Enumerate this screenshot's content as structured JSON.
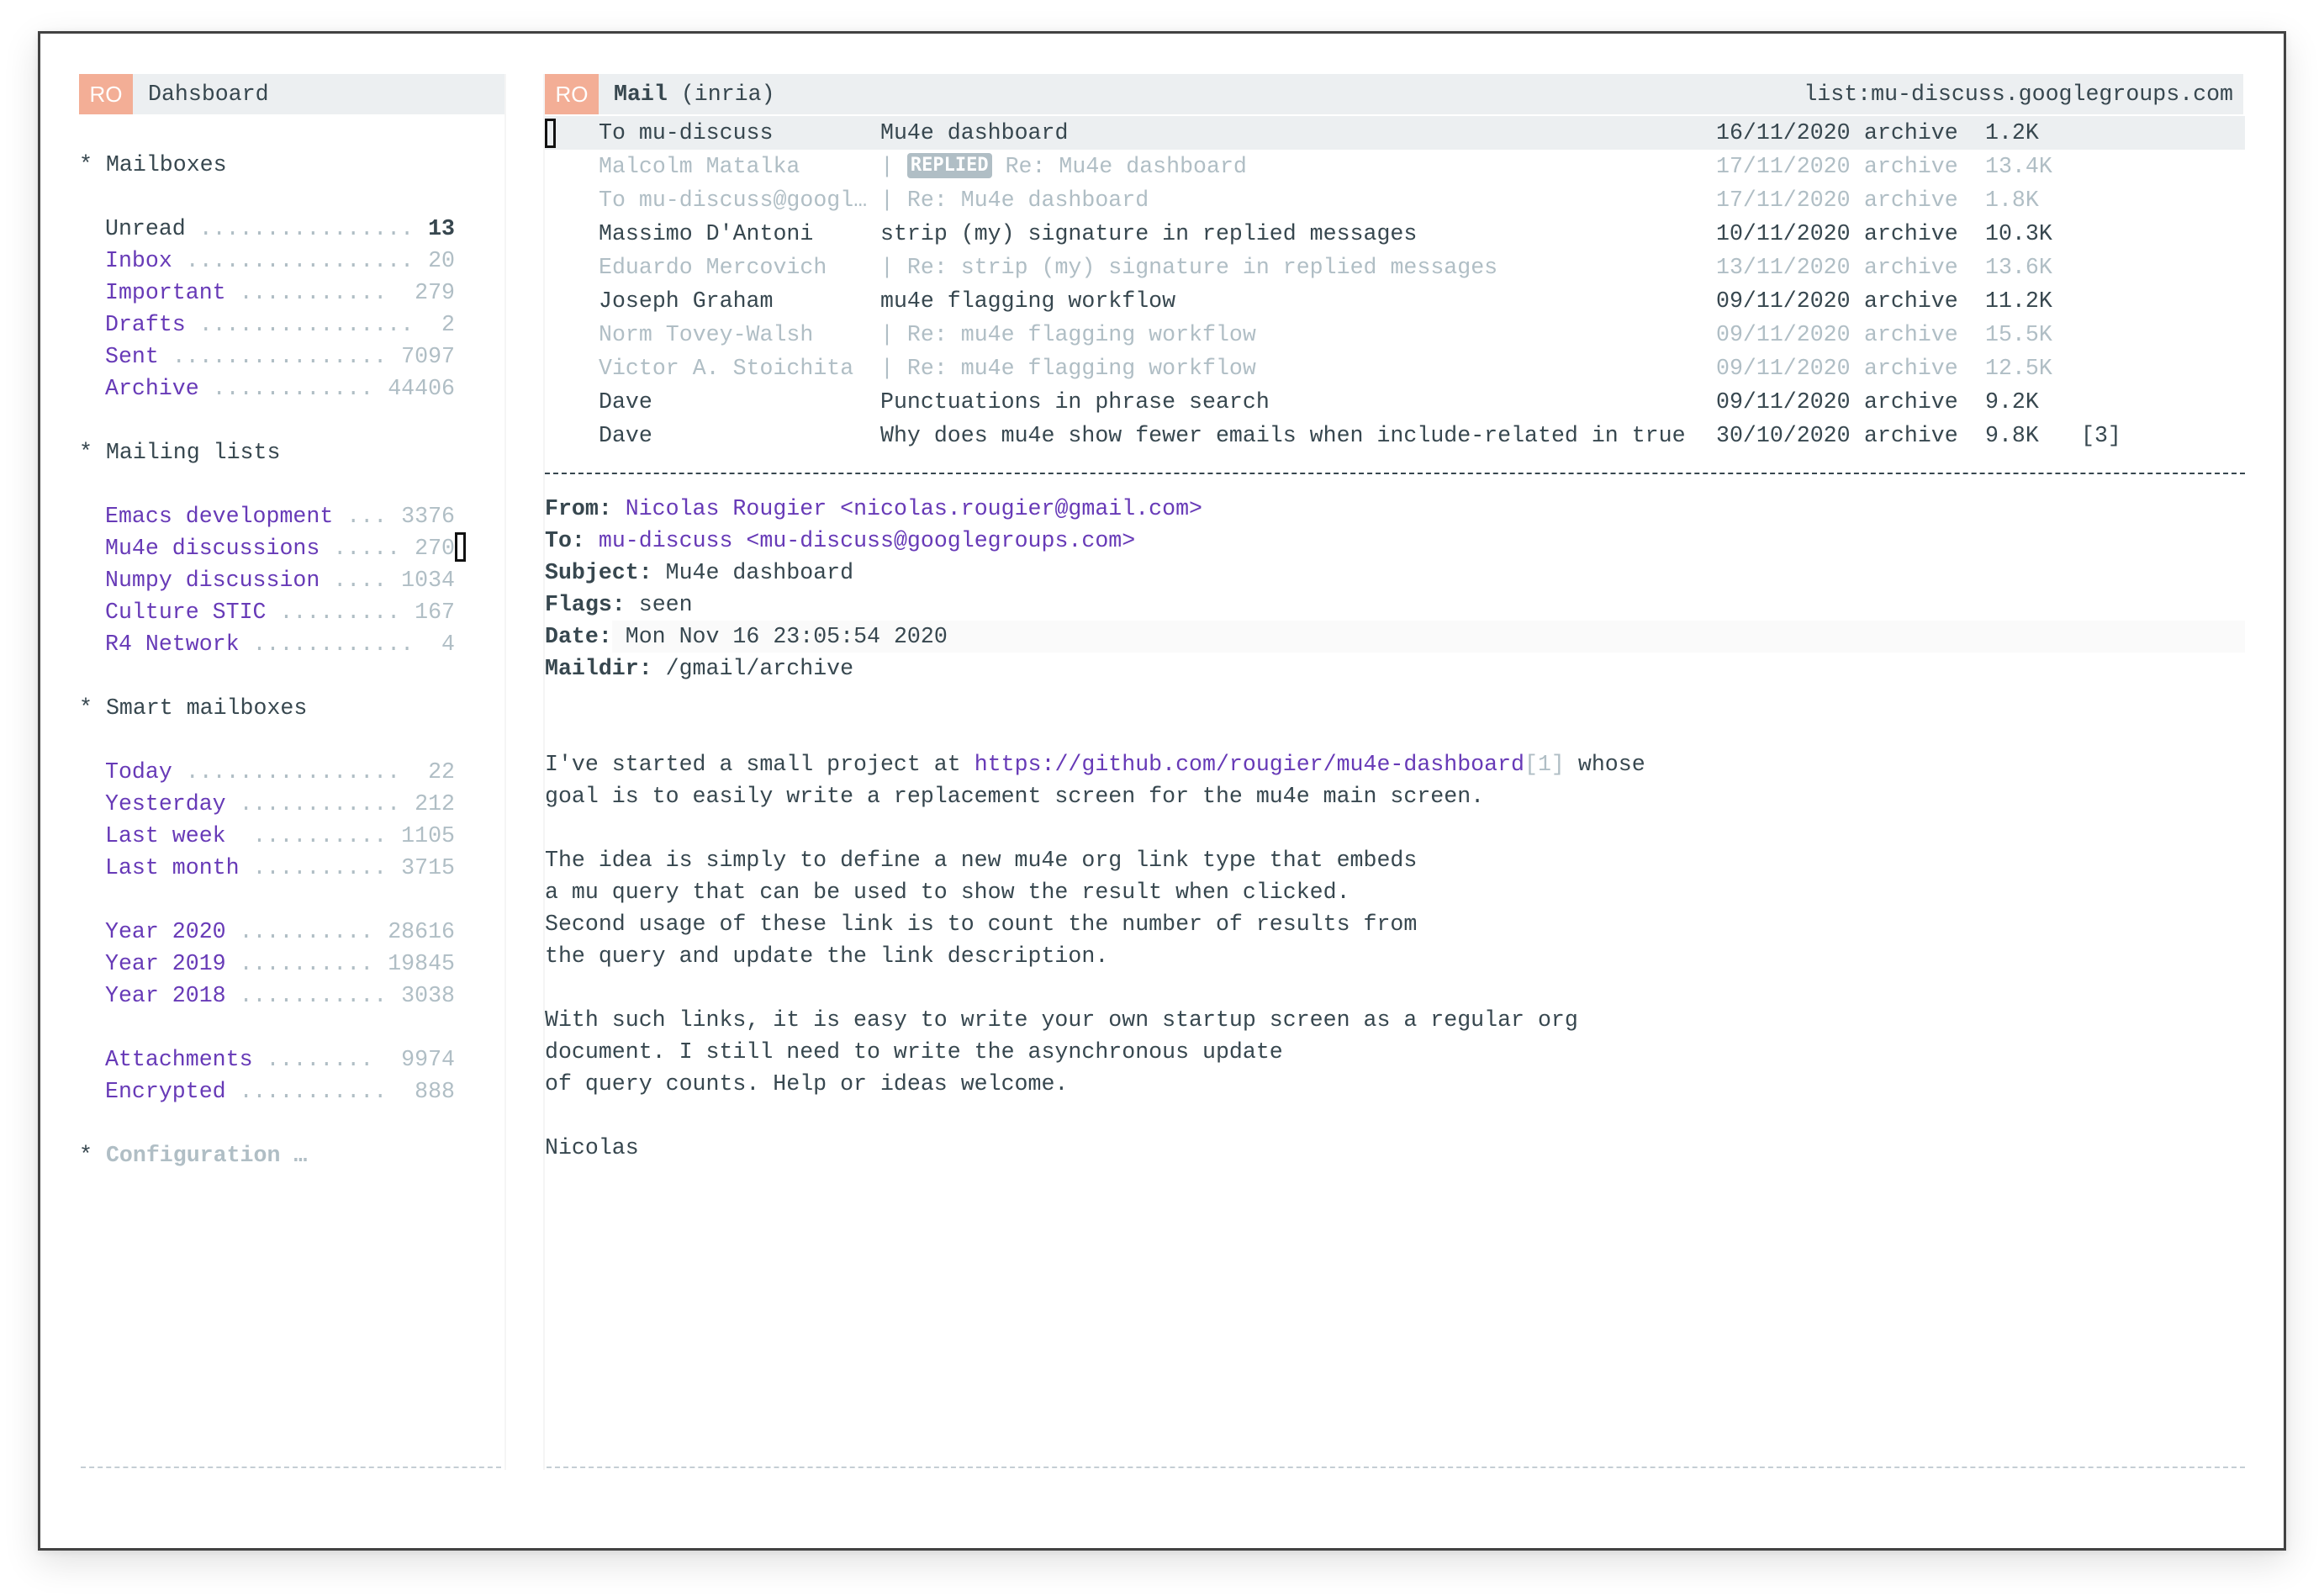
{
  "sidebar": {
    "badge": "RO",
    "title": "Dahsboard",
    "sections": {
      "mailboxes": {
        "heading": "Mailboxes",
        "items": [
          {
            "label": "Unread",
            "dots": "................",
            "count": "13"
          },
          {
            "label": "Inbox",
            "dots": ".................",
            "count": "20"
          },
          {
            "label": "Important",
            "dots": "...........",
            "count": "279"
          },
          {
            "label": "Drafts",
            "dots": "................",
            "count": "2"
          },
          {
            "label": "Sent",
            "dots": "................",
            "count": "7097"
          },
          {
            "label": "Archive",
            "dots": "............",
            "count": "44406"
          }
        ]
      },
      "mailing_lists": {
        "heading": "Mailing lists",
        "items": [
          {
            "label": "Emacs development",
            "dots": "...",
            "count": "3376"
          },
          {
            "label": "Mu4e discussions",
            "dots": ".....",
            "count": "270"
          },
          {
            "label": "Numpy discussion",
            "dots": "....",
            "count": "1034"
          },
          {
            "label": "Culture STIC",
            "dots": ".........",
            "count": "167"
          },
          {
            "label": "R4 Network",
            "dots": "............",
            "count": "4"
          }
        ]
      },
      "smart_mailboxes": {
        "heading": "Smart mailboxes",
        "items": [
          {
            "label": "Today",
            "dots": "................",
            "count": "22"
          },
          {
            "label": "Yesterday",
            "dots": "............",
            "count": "212"
          },
          {
            "label": "Last week",
            "dots": " ..........",
            "count": "1105"
          },
          {
            "label": "Last month",
            "dots": "..........",
            "count": "3715"
          },
          {
            "label": "Year 2020",
            "dots": "..........",
            "count": "28616"
          },
          {
            "label": "Year 2019",
            "dots": "..........",
            "count": "19845"
          },
          {
            "label": "Year 2018",
            "dots": "...........",
            "count": "3038"
          },
          {
            "label": "Attachments",
            "dots": "........",
            "count": "9974"
          },
          {
            "label": "Encrypted",
            "dots": "...........",
            "count": "888"
          }
        ]
      },
      "configuration": {
        "heading": "Configuration …"
      }
    },
    "star": "*"
  },
  "mail": {
    "badge": "RO",
    "title": "Mail",
    "account": "(inria)",
    "query": "list:mu-discuss.googlegroups.com",
    "messages": [
      {
        "from": "To mu-discuss",
        "prefix": "",
        "tag": "",
        "subject": "Mu4e dashboard",
        "date": "16/11/2020",
        "folder": "archive",
        "size": "1.2K",
        "count": ""
      },
      {
        "from": "Malcolm Matalka",
        "prefix": "| ",
        "tag": "REPLIED",
        "subject": " Re: Mu4e dashboard",
        "date": "17/11/2020",
        "folder": "archive",
        "size": "13.4K",
        "count": ""
      },
      {
        "from": "To mu-discuss@googl…",
        "prefix": "| ",
        "tag": "",
        "subject": "Re: Mu4e dashboard",
        "date": "17/11/2020",
        "folder": "archive",
        "size": "1.8K",
        "count": ""
      },
      {
        "from": "Massimo D'Antoni",
        "prefix": "",
        "tag": "",
        "subject": "strip (my) signature in replied messages",
        "date": "10/11/2020",
        "folder": "archive",
        "size": "10.3K",
        "count": ""
      },
      {
        "from": "Eduardo Mercovich",
        "prefix": "| ",
        "tag": "",
        "subject": "Re: strip (my) signature in replied messages",
        "date": "13/11/2020",
        "folder": "archive",
        "size": "13.6K",
        "count": ""
      },
      {
        "from": "Joseph Graham",
        "prefix": "",
        "tag": "",
        "subject": "mu4e flagging workflow",
        "date": "09/11/2020",
        "folder": "archive",
        "size": "11.2K",
        "count": ""
      },
      {
        "from": "Norm Tovey-Walsh",
        "prefix": "| ",
        "tag": "",
        "subject": "Re: mu4e flagging workflow",
        "date": "09/11/2020",
        "folder": "archive",
        "size": "15.5K",
        "count": ""
      },
      {
        "from": "Victor A. Stoichita",
        "prefix": "| ",
        "tag": "",
        "subject": "Re: mu4e flagging workflow",
        "date": "09/11/2020",
        "folder": "archive",
        "size": "12.5K",
        "count": ""
      },
      {
        "from": "Dave",
        "prefix": "",
        "tag": "",
        "subject": "Punctuations in phrase search",
        "date": "09/11/2020",
        "folder": "archive",
        "size": "9.2K",
        "count": ""
      },
      {
        "from": "Dave",
        "prefix": "",
        "tag": "",
        "subject": "Why does mu4e show fewer emails when include-related in true",
        "date": "30/10/2020",
        "folder": "archive",
        "size": "9.8K",
        "count": "[3]"
      }
    ]
  },
  "view": {
    "headers": {
      "from_label": "From:",
      "from_name": "Nicolas Rougier",
      "from_email": "<nicolas.rougier@gmail.com>",
      "to_label": "To:",
      "to_name": "mu-discuss",
      "to_email": "<mu-discuss@googlegroups.com>",
      "subject_label": "Subject:",
      "subject": "Mu4e dashboard",
      "flags_label": "Flags:",
      "flags": "seen",
      "date_label": "Date:",
      "date": "Mon Nov 16 23:05:54 2020",
      "maildir_label": "Maildir:",
      "maildir": "/gmail/archive"
    },
    "body": {
      "p1_pre": "I've started a small project at ",
      "p1_link": "https://github.com/rougier/mu4e-dashboard",
      "p1_ref": "[1]",
      "p1_post": " whose",
      "p1_line2": "goal is to easily write a replacement screen for the mu4e main screen.",
      "p2": [
        "The idea is simply to define a new mu4e org link type that embeds",
        "a mu query that can be used to show the result when clicked.",
        "Second usage of these link is to count the number of results from",
        "the query and update the link description."
      ],
      "p3": [
        "With such links, it is easy to write your own startup screen as a regular org",
        "document. I still need to write the asynchronous update",
        "of query counts. Help or ideas welcome."
      ],
      "signature": "Nicolas"
    }
  },
  "colors": {
    "text": "#37474f",
    "faded": "#b0bec5",
    "link": "#673ab7",
    "header_bg": "#eceff1",
    "badge_bg": "#f3ae96"
  }
}
